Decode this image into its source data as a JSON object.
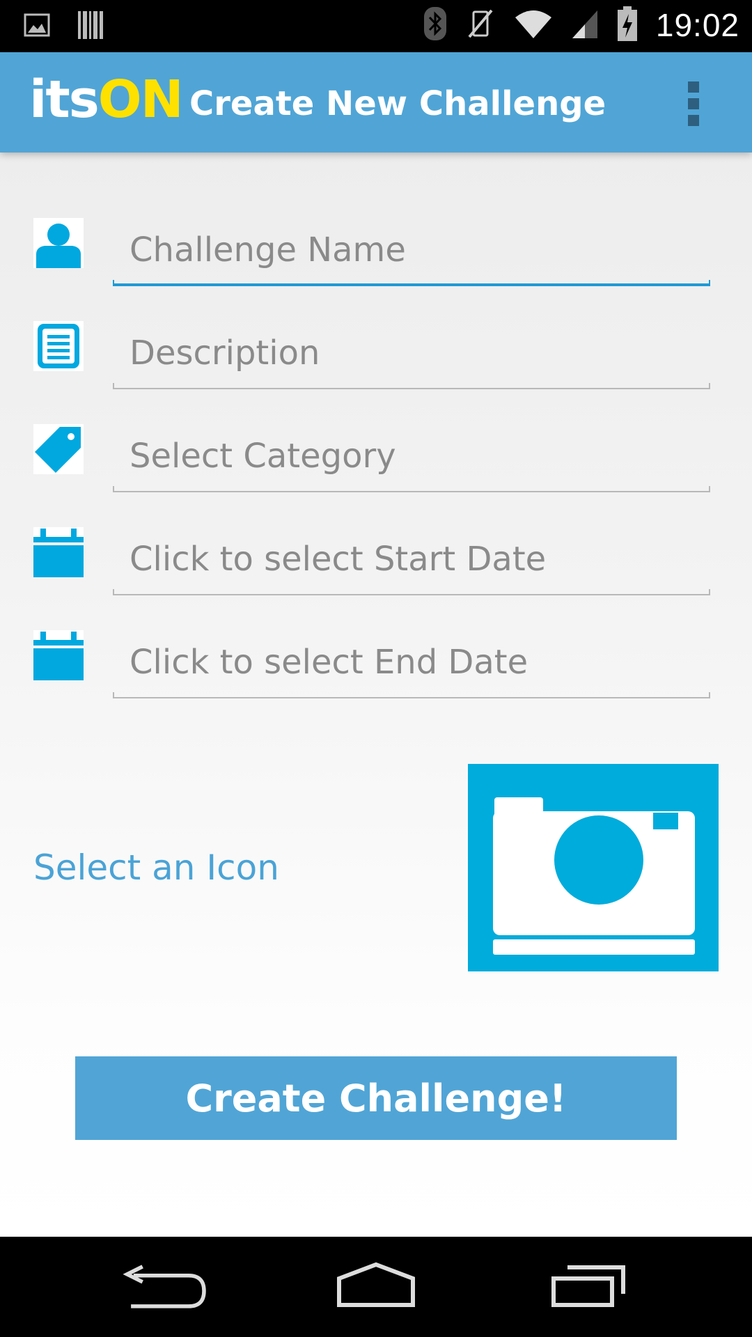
{
  "status_bar": {
    "time": "19:02",
    "left_icons": [
      "image-notification-icon",
      "barcode-notification-icon"
    ],
    "right_icons": [
      "bluetooth-icon",
      "vibrate-mute-icon",
      "wifi-icon",
      "cell-signal-icon",
      "battery-charging-icon"
    ]
  },
  "action_bar": {
    "logo_its": "its",
    "logo_on": "ON",
    "title": "Create New Challenge",
    "overflow_icon": "overflow-menu-icon"
  },
  "form": {
    "fields": [
      {
        "icon": "person-icon",
        "placeholder": "Challenge Name",
        "focused": true
      },
      {
        "icon": "document-icon",
        "placeholder": "Description",
        "focused": false
      },
      {
        "icon": "tag-icon",
        "placeholder": "Select Category",
        "focused": false
      },
      {
        "icon": "calendar-icon",
        "placeholder": "Click to select Start Date",
        "focused": false
      },
      {
        "icon": "calendar-icon",
        "placeholder": "Click to select End Date",
        "focused": false
      }
    ],
    "select_icon_label": "Select an Icon",
    "icon_picker_icon": "camera-icon",
    "create_button": "Create Challenge!"
  },
  "colors": {
    "accent": "#50a5d6",
    "logo_yellow": "#ffe100",
    "icon_blue": "#00a8df",
    "focus_line": "#1e9ad6"
  },
  "nav_bar": {
    "buttons": [
      "back-icon",
      "home-icon",
      "recent-apps-icon"
    ]
  }
}
